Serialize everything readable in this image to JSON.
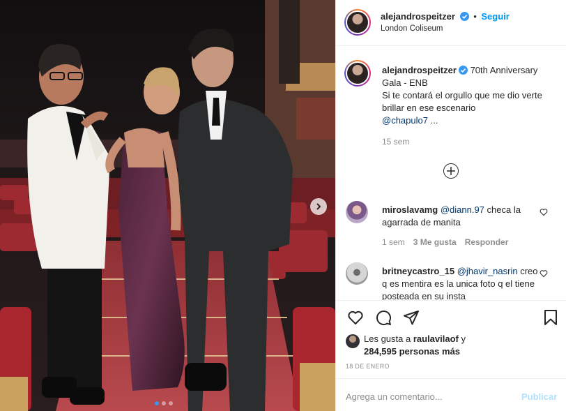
{
  "post": {
    "author": "alejandrospeitzer",
    "separator": "•",
    "follow_label": "Seguir",
    "location": "London Coliseum",
    "caption": {
      "author": "alejandrospeitzer",
      "title": "70th Anniversary Gala - ENB",
      "body": "Si te contará el orgullo que me dio verte brillar en ese escenario",
      "mention": "@chapulo7",
      "ellipsis": "...",
      "time": "15 sem"
    },
    "more_comments_icon": "plus-circle-icon",
    "carousel": {
      "slide_count": 3,
      "active_index": 0
    }
  },
  "comments": [
    {
      "user": "miroslavamg",
      "mention": "@diann.97",
      "text": " checa la agarrada de manita",
      "time": "1 sem",
      "likes": "3 Me gusta",
      "reply": "Responder"
    },
    {
      "user": "britneycastro_15",
      "mention": "@jhavir_nasrin",
      "text": " creo q es mentira es la unica foto q el tiene posteada en su insta"
    }
  ],
  "likes": {
    "prefix": "Les gusta a",
    "first_user": "raulavilaof",
    "conjunction": "y",
    "count_text": "284,595 personas más"
  },
  "date": "18 DE ENERO",
  "composer": {
    "placeholder": "Agrega un comentario...",
    "publish_label": "Publicar"
  },
  "colors": {
    "accent": "#0095f6",
    "verified": "#3897f0",
    "publish_disabled": "#b2dffc",
    "border": "#efefef"
  }
}
